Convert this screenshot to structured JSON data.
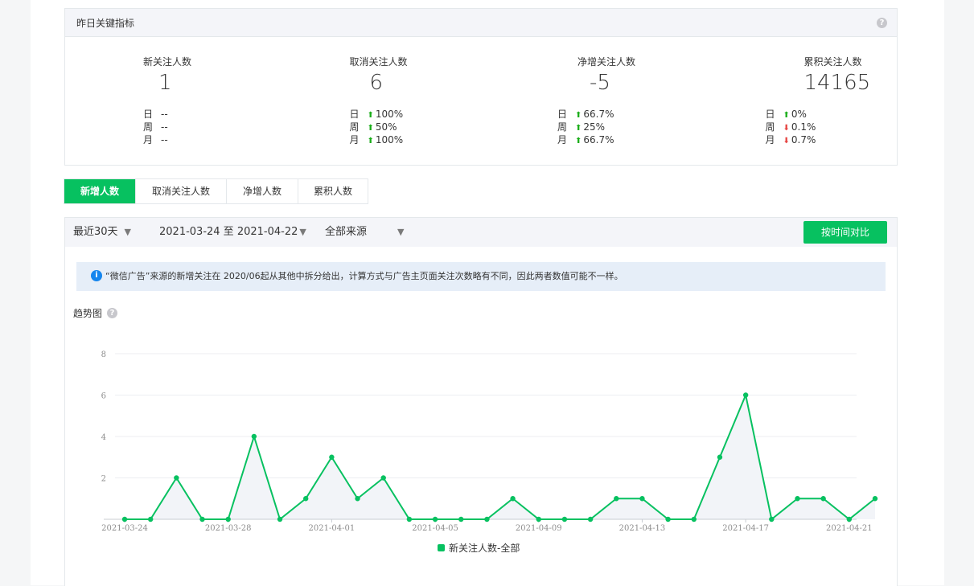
{
  "metrics": {
    "title": "昨日关键指标",
    "help_icon": "question-circle-icon",
    "items": [
      {
        "label": "新关注人数",
        "value": "1",
        "rows": [
          {
            "period": "日",
            "trend": "none",
            "text": "--"
          },
          {
            "period": "周",
            "trend": "none",
            "text": "--"
          },
          {
            "period": "月",
            "trend": "none",
            "text": "--"
          }
        ]
      },
      {
        "label": "取消关注人数",
        "value": "6",
        "rows": [
          {
            "period": "日",
            "trend": "up",
            "text": "100%"
          },
          {
            "period": "周",
            "trend": "up",
            "text": "50%"
          },
          {
            "period": "月",
            "trend": "up",
            "text": "100%"
          }
        ]
      },
      {
        "label": "净增关注人数",
        "value": "-5",
        "rows": [
          {
            "period": "日",
            "trend": "up",
            "text": "66.7%"
          },
          {
            "period": "周",
            "trend": "up",
            "text": "25%"
          },
          {
            "period": "月",
            "trend": "up",
            "text": "66.7%"
          }
        ]
      },
      {
        "label": "累积关注人数",
        "value": "14165",
        "rows": [
          {
            "period": "日",
            "trend": "up",
            "text": "0%"
          },
          {
            "period": "周",
            "trend": "down",
            "text": "0.1%"
          },
          {
            "period": "月",
            "trend": "down",
            "text": "0.7%"
          }
        ]
      }
    ]
  },
  "tabs": [
    {
      "label": "新增人数",
      "active": true
    },
    {
      "label": "取消关注人数",
      "active": false
    },
    {
      "label": "净增人数",
      "active": false
    },
    {
      "label": "累积人数",
      "active": false
    }
  ],
  "filters": {
    "range": "最近30天",
    "dates": "2021-03-24 至 2021-04-22",
    "source": "全部来源",
    "compare_button": "按时间对比"
  },
  "notice": "“微信广告”来源的新增关注在 2020/06起从其他中拆分给出，计算方式与广告主页面关注次数略有不同，因此两者数值可能不一样。",
  "trend_title": "趋势图",
  "colors": {
    "accent": "#07c160",
    "up": "#1aad19",
    "down": "#e64340",
    "info": "#1485ee"
  },
  "chart_data": {
    "type": "line",
    "legend": "新关注人数-全部",
    "legend_position": "bottom-center",
    "grid": true,
    "ylim": [
      0,
      8
    ],
    "yticks": [
      2,
      4,
      6,
      8
    ],
    "x": [
      "2021-03-24",
      "2021-03-25",
      "2021-03-26",
      "2021-03-27",
      "2021-03-28",
      "2021-03-29",
      "2021-03-30",
      "2021-03-31",
      "2021-04-01",
      "2021-04-02",
      "2021-04-03",
      "2021-04-04",
      "2021-04-05",
      "2021-04-06",
      "2021-04-07",
      "2021-04-08",
      "2021-04-09",
      "2021-04-10",
      "2021-04-11",
      "2021-04-12",
      "2021-04-13",
      "2021-04-14",
      "2021-04-15",
      "2021-04-16",
      "2021-04-17",
      "2021-04-18",
      "2021-04-19",
      "2021-04-20",
      "2021-04-21",
      "2021-04-22"
    ],
    "xtick_labels": [
      "2021-03-24",
      "2021-03-28",
      "2021-04-01",
      "2021-04-05",
      "2021-04-09",
      "2021-04-13",
      "2021-04-17",
      "2021-04-21"
    ],
    "series": [
      {
        "name": "新关注人数-全部",
        "values": [
          0,
          0,
          2,
          0,
          0,
          4,
          0,
          1,
          3,
          1,
          2,
          0,
          0,
          0,
          0,
          1,
          0,
          0,
          0,
          1,
          1,
          0,
          0,
          3,
          6,
          0,
          1,
          1,
          0,
          1
        ]
      }
    ]
  }
}
